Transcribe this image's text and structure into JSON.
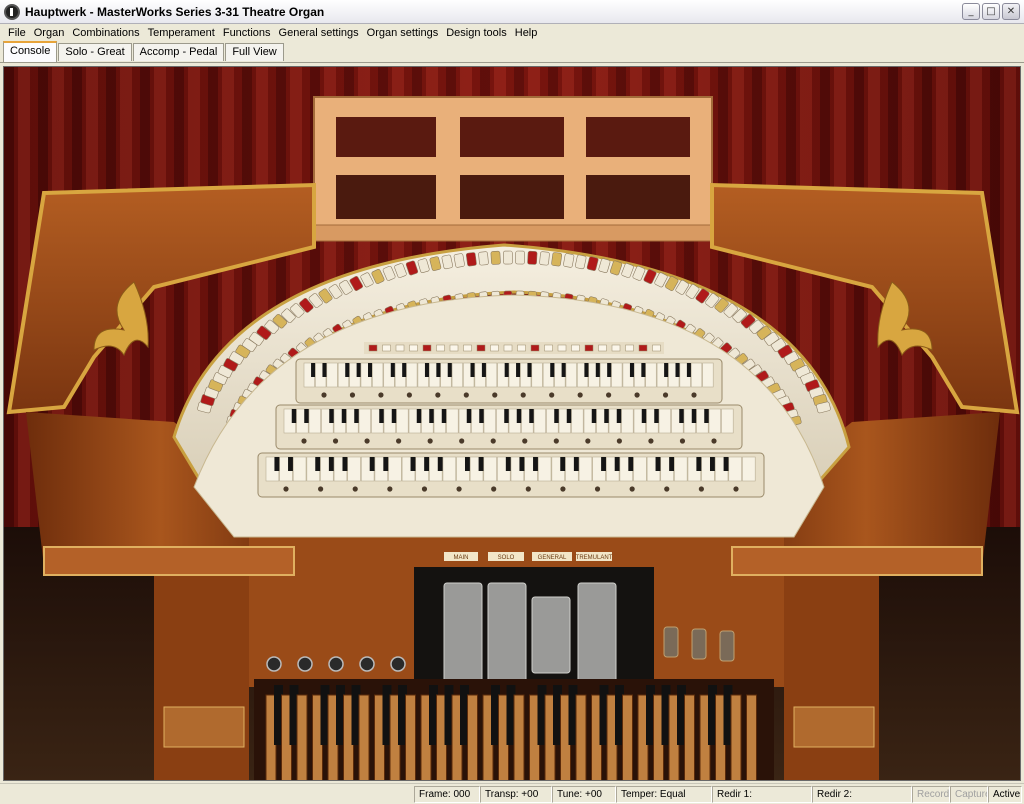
{
  "window": {
    "title": "Hauptwerk - MasterWorks Series 3-31 Theatre Organ",
    "minimize": "_",
    "maximize": "□",
    "close": "✕"
  },
  "menu": {
    "items": [
      "File",
      "Organ",
      "Combinations",
      "Temperament",
      "Functions",
      "General settings",
      "Organ settings",
      "Design tools",
      "Help"
    ]
  },
  "tabs": {
    "items": [
      "Console",
      "Solo - Great",
      "Accomp - Pedal",
      "Full View"
    ],
    "active": 0
  },
  "console": {
    "plaques": [
      "MAIN",
      "SOLO",
      "GENERAL",
      "TREMULANT"
    ],
    "manuals": 3,
    "swell_shoes": 4,
    "pedal_keys": 32,
    "colors": {
      "curtain": "#7a140f",
      "wood": "#9a4b18",
      "gold": "#d8a640",
      "ivory": "#efe8d6",
      "stop_red": "#b01a1a"
    }
  },
  "status": {
    "frame": "Frame: 000",
    "transp": "Transp: +00",
    "tune": "Tune: +00",
    "temper": "Temper: Equal",
    "redir1": "Redir 1:",
    "redir2": "Redir 2:",
    "record": "Record",
    "capture": "Capture",
    "active": "Active"
  }
}
